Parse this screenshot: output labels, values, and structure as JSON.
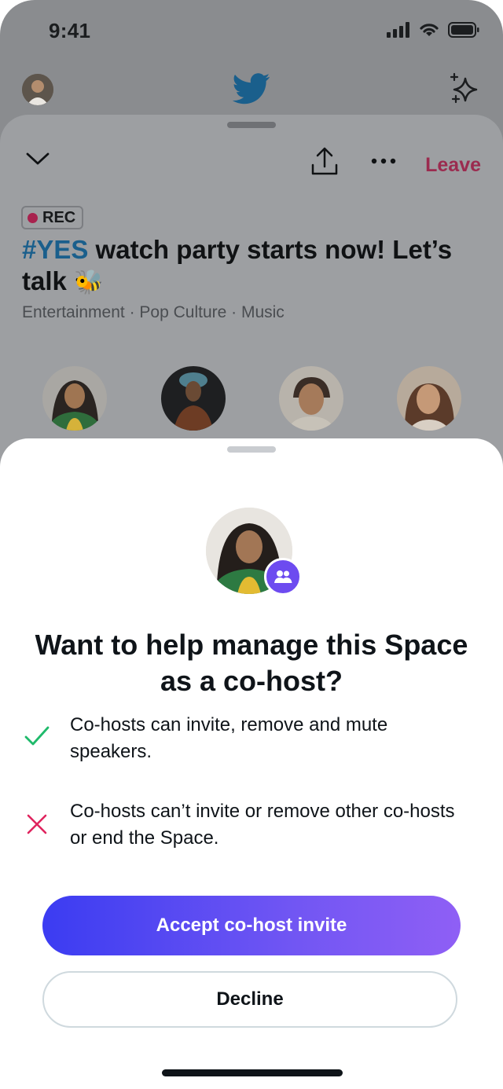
{
  "status_bar": {
    "time": "9:41"
  },
  "space": {
    "leave_label": "Leave",
    "rec_label": "REC",
    "title_hashtag": "#YES",
    "title_rest": " watch party starts now! Let’s talk ",
    "title_emoji": "🐝",
    "tags": "Entertainment · Pop Culture · Music"
  },
  "sheet": {
    "title": "Want to help manage this Space as a co-host?",
    "bullets": [
      {
        "icon": "check-icon",
        "text": "Co-hosts can invite, remove and mute speakers."
      },
      {
        "icon": "x-icon",
        "text": "Co-hosts can’t invite or remove other co-hosts or end the Space."
      }
    ],
    "accept_label": "Accept co-host invite",
    "decline_label": "Decline"
  },
  "colors": {
    "accent_gradient_start": "#3b3cf2",
    "accent_gradient_end": "#8f5ff5",
    "check": "#1fba6b",
    "cross": "#e0245e",
    "leave": "#9b2b4f"
  }
}
